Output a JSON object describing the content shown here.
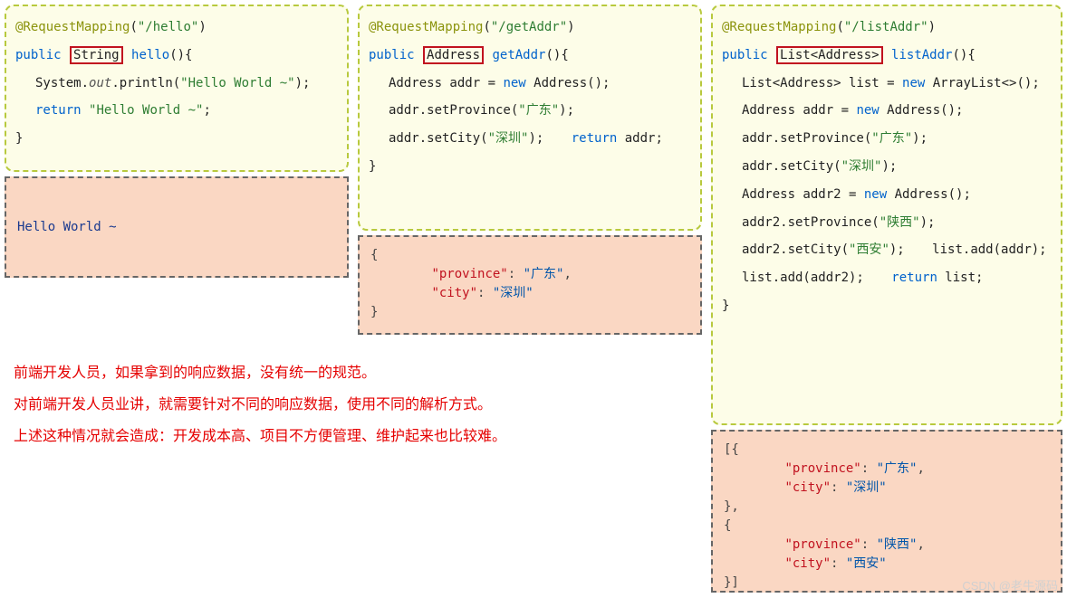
{
  "col1": {
    "ann": "@RequestMapping",
    "annArg": "\"/hello\"",
    "kw_public": "public",
    "retType": "String",
    "fn": "hello",
    "sysCall_a": "System.",
    "sysCall_b": "out",
    "sysCall_c": ".println(",
    "sysStr": "\"Hello World ~\"",
    "ret": "return",
    "retStr": "\"Hello World ~\"",
    "output": "Hello World ~"
  },
  "col2": {
    "ann": "@RequestMapping",
    "annArg": "\"/getAddr\"",
    "kw_public": "public",
    "retType": "Address",
    "fn": "getAddr",
    "l1a": "Address addr = ",
    "l1new": "new",
    "l1b": " Address();",
    "l2a": "addr.setProvince(",
    "l2s": "\"广东\"",
    "l3a": "addr.setCity(",
    "l3s": "\"深圳\"",
    "ret": "return",
    "retv": " addr;",
    "out": {
      "k1": "\"province\"",
      "v1": "\"广东\"",
      "k2": "\"city\"",
      "v2": "\"深圳\""
    }
  },
  "col3": {
    "ann": "@RequestMapping",
    "annArg": "\"/listAddr\"",
    "kw_public": "public",
    "retType": "List<Address>",
    "fn": "listAddr",
    "l1a": "List<Address> list = ",
    "l1new": "new",
    "l1b": " ArrayList<>();",
    "l2a": "Address addr = ",
    "l2new": "new",
    "l2b": " Address();",
    "l3a": "addr.setProvince(",
    "l3s": "\"广东\"",
    "l4a": "addr.setCity(",
    "l4s": "\"深圳\"",
    "l5a": "Address addr2 = ",
    "l5new": "new",
    "l5b": " Address();",
    "l6a": "addr2.setProvince(",
    "l6s": "\"陕西\"",
    "l7a": "addr2.setCity(",
    "l7s": "\"西安\"",
    "l8": "list.add(addr);",
    "l9": "list.add(addr2);",
    "ret": "return",
    "retv": " list;",
    "out": {
      "k1": "\"province\"",
      "v1": "\"广东\"",
      "k2": "\"city\"",
      "v2": "\"深圳\"",
      "k3": "\"province\"",
      "v3": "\"陕西\"",
      "k4": "\"city\"",
      "v4": "\"西安\""
    }
  },
  "commentary": {
    "l1": "前端开发人员，如果拿到的响应数据，没有统一的规范。",
    "l2": "对前端开发人员业讲，就需要针对不同的响应数据，使用不同的解析方式。",
    "l3": "上述这种情况就会造成：开发成本高、项目不方便管理、维护起来也比较难。"
  },
  "watermark": "CSDN @老牛源码"
}
